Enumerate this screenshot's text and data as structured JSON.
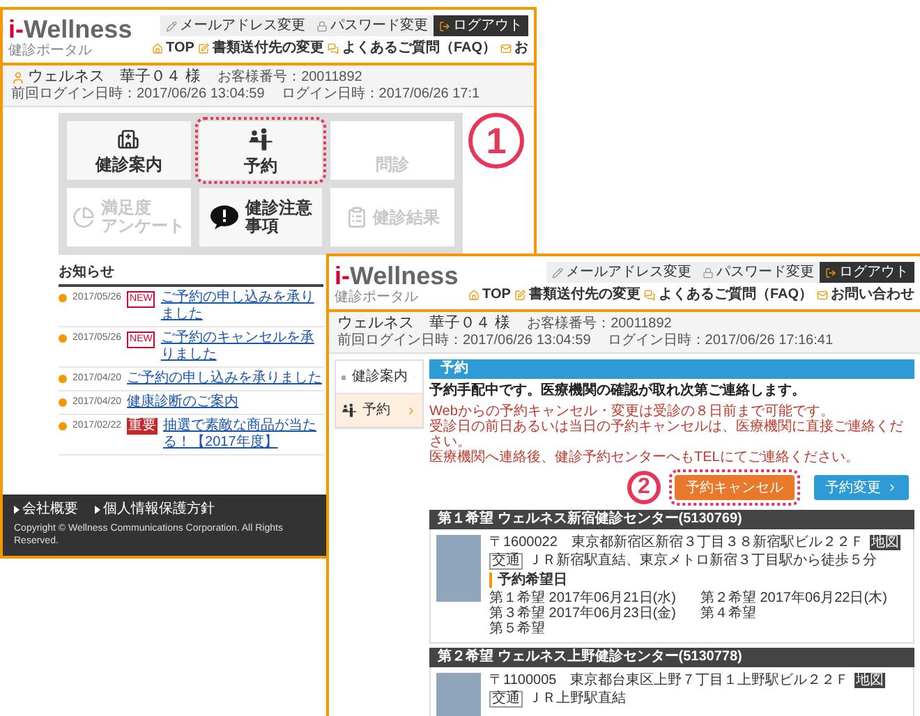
{
  "home_page": {
    "logo": {
      "mark": "i-",
      "name": "Wellness",
      "subtitle": "健診ポータル"
    },
    "account_links": [
      {
        "label": "メールアドレス変更",
        "kind": "link"
      },
      {
        "label": "パスワード変更",
        "kind": "link"
      },
      {
        "label": "ログアウト",
        "kind": "logout"
      }
    ],
    "nav": [
      "TOP",
      "書類送付先の変更",
      "よくあるご質問（FAQ）",
      "お"
    ],
    "user": {
      "name": "ウェルネス　華子０４ 様",
      "info": [
        "お客様番号：20011892",
        "前回ログイン日時：2017/06/26 13:04:59",
        "ログイン日時：2017/06/26 17:1"
      ]
    },
    "tiles": [
      {
        "label": "健診案内",
        "enabled": true,
        "highlighted": false
      },
      {
        "label": "予約",
        "enabled": true,
        "highlighted": true,
        "step": "1"
      },
      {
        "label": "問診",
        "enabled": false,
        "highlighted": false
      },
      {
        "label": [
          "満足度",
          "アンケート"
        ],
        "enabled": false,
        "highlighted": false
      },
      {
        "label": [
          "健診注意",
          "事項"
        ],
        "enabled": true,
        "highlighted": false
      },
      {
        "label": "健診結果",
        "enabled": false,
        "highlighted": false
      }
    ],
    "news": {
      "title": "お知らせ",
      "items": [
        {
          "date": "2017/05/26",
          "badge": {
            "kind": "new",
            "text": "NEW"
          },
          "text": "ご予約の申し込みを承りました"
        },
        {
          "date": "2017/05/26",
          "badge": {
            "kind": "new",
            "text": "NEW"
          },
          "text": "ご予約のキャンセルを承りました"
        },
        {
          "date": "2017/04/20",
          "text": "ご予約の申し込みを承りました"
        },
        {
          "date": "2017/04/20",
          "text": "健康診断のご案内"
        },
        {
          "date": "2017/02/22",
          "badge": {
            "kind": "important",
            "text": "重要"
          },
          "text": "抽選で素敵な商品が当たる！【2017年度】"
        }
      ]
    },
    "footer": {
      "links": [
        "会社概要",
        "個人情報保護方針"
      ],
      "copyright": "Copyright © Wellness Communications Corporation. All Rights Reserved."
    }
  },
  "reservation_page": {
    "logo": {
      "mark": "i-",
      "name": "Wellness",
      "subtitle": "健診ポータル"
    },
    "account_links": [
      {
        "label": "メールアドレス変更",
        "kind": "link"
      },
      {
        "label": "パスワード変更",
        "kind": "link"
      },
      {
        "label": "ログアウト",
        "kind": "logout"
      }
    ],
    "nav": [
      "TOP",
      "書類送付先の変更",
      "よくあるご質問（FAQ）",
      "お問い合わせ"
    ],
    "user": {
      "name": "ウェルネス　華子０４ 様",
      "info": [
        "お客様番号：20011892",
        "前回ログイン日時：2017/06/26 13:04:59",
        "ログイン日時：2017/06/26 17:16:41"
      ]
    },
    "sidebar": [
      {
        "label": "健診案内",
        "selected": false
      },
      {
        "label": "予約",
        "selected": true
      }
    ],
    "section_title": "予約",
    "message": "予約手配中です。医療機関の確認が取れ次第ご連絡します。",
    "notes": [
      "Webからの予約キャンセル・変更は受診の８日前まで可能です。",
      "受診日の前日あるいは当日の予約キャンセルは、医療機関に直接ご連絡ください。",
      "医療機関へ連絡後、健診予約センターへもTELにてご連絡ください。"
    ],
    "buttons": [
      {
        "label": "予約キャンセル",
        "kind": "cancel",
        "highlighted": true,
        "step": "2"
      },
      {
        "label": "予約変更",
        "kind": "change",
        "highlighted": false
      }
    ],
    "facilities": [
      {
        "title": "第１希望 ウェルネス新宿健診センター(5130769)",
        "address": "〒1600022　東京都新宿区新宿３丁目３８新宿駅ビル２２Ｆ",
        "map_label": "地図",
        "access_label": "交通",
        "access": "ＪＲ新宿駅直結、東京メトロ新宿３丁目駅から徒歩５分",
        "dates_title": "予約希望日",
        "dates": [
          "第１希望 2017年06月21日(水)",
          "第２希望 2017年06月22日(木)",
          "第３希望 2017年06月23日(金)",
          "第４希望",
          "第５希望"
        ]
      },
      {
        "title": "第２希望 ウェルネス上野健診センター(5130778)",
        "address": "〒1100005　東京都台東区上野７丁目１上野駅ビル２２Ｆ",
        "map_label": "地図",
        "access_label": "交通",
        "access": "ＪＲ上野駅直結"
      }
    ]
  }
}
